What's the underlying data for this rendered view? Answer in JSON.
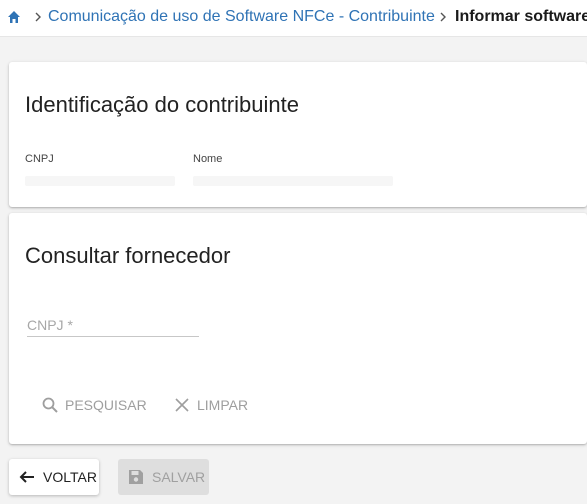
{
  "breadcrumb": {
    "home_icon": "home-icon",
    "link": "Comunicação de uso de Software NFCe - Contribuinte",
    "current": "Informar software"
  },
  "identificacao": {
    "title": "Identificação do contribuinte",
    "cnpj_label": "CNPJ",
    "nome_label": "Nome"
  },
  "consultar": {
    "title": "Consultar fornecedor",
    "cnpj_placeholder": "CNPJ *",
    "search_label": "PESQUISAR",
    "clear_label": "LIMPAR"
  },
  "footer": {
    "back_label": "VOLTAR",
    "save_label": "SALVAR"
  },
  "colors": {
    "link": "#2f73b5",
    "background": "#f3f3f3",
    "disabled_text": "#9e9e9e"
  }
}
